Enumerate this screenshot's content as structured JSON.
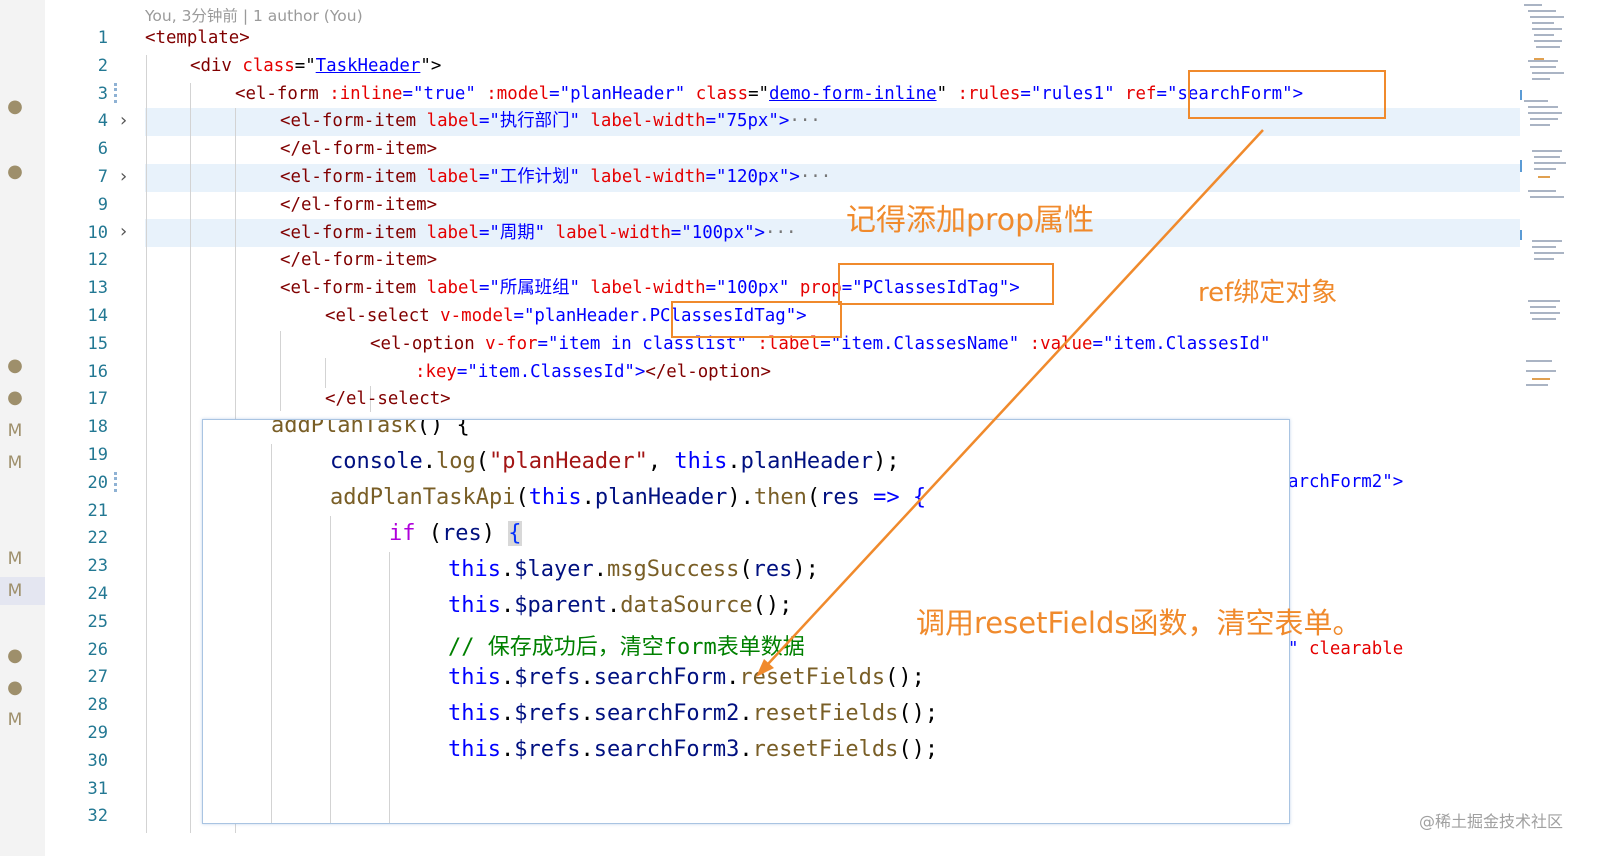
{
  "blame": "You, 3分钟前 | 1 author (You)",
  "line_numbers": [
    "1",
    "2",
    "3",
    "4",
    "6",
    "7",
    "9",
    "10",
    "12",
    "13",
    "14",
    "15",
    "16",
    "17",
    "18",
    "19",
    "20",
    "21",
    "22",
    "23",
    "24",
    "25",
    "26",
    "27",
    "28",
    "29",
    "30",
    "31",
    "32"
  ],
  "gutter_markers": [
    "●",
    "●",
    "●",
    "●",
    "M",
    "M",
    "M",
    "M",
    "●",
    "●",
    "M"
  ],
  "code": {
    "l1": [
      "<template>"
    ],
    "l2": [
      "<div ",
      "class",
      "=\"",
      "TaskHeader",
      "\">"
    ],
    "l3": [
      "<el-form ",
      ":inline",
      "=\"true\" ",
      ":model",
      "=\"planHeader\" ",
      "class",
      "=\"",
      "demo-form-inline",
      "\" ",
      ":rules",
      "=\"rules1\" ",
      "ref",
      "=\"searchForm\">"
    ],
    "l4": [
      "<el-form-item ",
      "label",
      "=\"执行部门\" ",
      "label-width",
      "=\"75px\">",
      "···"
    ],
    "l6": [
      "</el-form-item>"
    ],
    "l7": [
      "<el-form-item ",
      "label",
      "=\"工作计划\" ",
      "label-width",
      "=\"120px\">",
      "···"
    ],
    "l9": [
      "</el-form-item>"
    ],
    "l10": [
      "<el-form-item ",
      "label",
      "=\"周期\" ",
      "label-width",
      "=\"100px\">",
      "···"
    ],
    "l12": [
      "</el-form-item>"
    ],
    "l13": [
      "<el-form-item ",
      "label",
      "=\"所属班组\" ",
      "label-width",
      "=\"100px\" ",
      "prop",
      "=\"PClassesIdTag\">"
    ],
    "l14": [
      "<el-select ",
      "v-model",
      "=\"planHeader.PClassesIdTag\">"
    ],
    "l15": [
      "<el-option ",
      "v-for",
      "=\"item in classlist\" ",
      ":label",
      "=\"item.ClassesName\" ",
      ":value",
      "=\"item.ClassesId\""
    ],
    "l16": [
      ":key",
      "=\"item.ClassesId\">",
      "</el-option>"
    ],
    "l17": [
      "</el-select>"
    ],
    "l20_tail": "archForm2\">",
    "l26_tail_a": "\" ",
    "l26_tail_b": "clearable"
  },
  "overlay": {
    "o1": [
      "addPlanTask",
      "() {"
    ],
    "o2": [
      "console",
      ".",
      "log",
      "(",
      "\"planHeader\"",
      ", ",
      "this",
      ".",
      "planHeader",
      ");"
    ],
    "o3": [
      "addPlanTaskApi",
      "(",
      "this",
      ".",
      "planHeader",
      ").",
      "then",
      "(",
      "res",
      " => {"
    ],
    "o4": [
      "if",
      " (",
      "res",
      ") ",
      "{"
    ],
    "o5": [
      "this",
      ".",
      "$layer",
      ".",
      "msgSuccess",
      "(",
      "res",
      ");"
    ],
    "o6": [
      "this",
      ".",
      "$parent",
      ".",
      "dataSource",
      "();"
    ],
    "o7": "// 保存成功后，清空form表单数据",
    "o8": [
      "this",
      ".",
      "$refs",
      ".",
      "searchForm",
      ".",
      "resetFields",
      "();"
    ],
    "o9": [
      "this",
      ".",
      "$refs",
      ".",
      "searchForm2",
      ".",
      "resetFields",
      "();"
    ],
    "o10": [
      "this",
      ".",
      "$refs",
      ".",
      "searchForm3",
      ".",
      "resetFields",
      "();"
    ]
  },
  "annotations": {
    "prop_note": "记得添加prop属性",
    "ref_note": "ref绑定对象",
    "reset_note": "调用resetFields函数，清空表单。"
  },
  "watermark": "@稀土掘金技术社区",
  "colors": {
    "annotation_orange": "#f08a2c",
    "line_number": "#237893",
    "tag": "#800000",
    "attribute": "#e50000",
    "attr_value": "#0000ff",
    "js_function": "#795e26",
    "js_variable": "#001080",
    "js_keyword": "#0000ff",
    "js_control": "#af00db",
    "js_string": "#a31515",
    "js_comment": "#008000"
  }
}
